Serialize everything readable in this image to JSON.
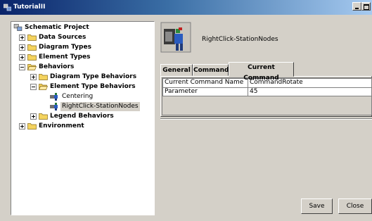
{
  "window": {
    "title": "TutorialII"
  },
  "tree": {
    "root": "Schematic Project",
    "items": [
      {
        "label": "Data Sources",
        "expanded": false
      },
      {
        "label": "Diagram Types",
        "expanded": false
      },
      {
        "label": "Element Types",
        "expanded": false
      },
      {
        "label": "Behaviors",
        "expanded": true,
        "children": [
          {
            "label": "Diagram Type Behaviors",
            "expanded": false
          },
          {
            "label": "Element Type Behaviors",
            "expanded": true,
            "children": [
              {
                "label": "Centering"
              },
              {
                "label": "RightClick-StationNodes",
                "selected": true
              }
            ]
          },
          {
            "label": "Legend Behaviors",
            "expanded": false
          }
        ]
      },
      {
        "label": "Environment",
        "expanded": false
      }
    ]
  },
  "detail": {
    "title": "RightClick-StationNodes",
    "tabs": [
      {
        "label": "General"
      },
      {
        "label": "Command"
      },
      {
        "label": "Current Command",
        "active": true
      }
    ],
    "properties": [
      {
        "name": "Current Command Name",
        "value": "CommandRotate"
      },
      {
        "name": "Parameter",
        "value": "45"
      }
    ]
  },
  "buttons": {
    "save": "Save",
    "close": "Close"
  }
}
